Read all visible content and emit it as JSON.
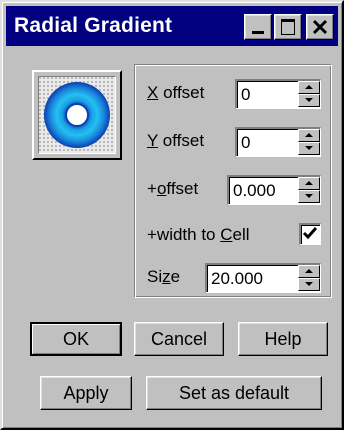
{
  "window": {
    "title": "Radial Gradient",
    "controls": [
      "minimize-icon",
      "maximize-icon",
      "close-icon"
    ]
  },
  "colors": {
    "titlebar": "#000080",
    "face": "#c0c0c0",
    "preview_ring": "#1aa0e6",
    "preview_ring_dark": "#0a3fb0"
  },
  "fields": {
    "x_offset": {
      "label_pre": "",
      "label_mnemonic": "X",
      "label_post": " offset",
      "value": "0"
    },
    "y_offset": {
      "label_pre": "",
      "label_mnemonic": "Y",
      "label_post": " offset",
      "value": "0"
    },
    "plus_offset": {
      "label_pre": "+",
      "label_mnemonic": "o",
      "label_post": "ffset",
      "value": "0.000"
    },
    "width_to_cell": {
      "label_pre": "+width to ",
      "label_mnemonic": "C",
      "label_post": "ell",
      "checked": true
    },
    "size": {
      "label_pre": "Si",
      "label_mnemonic": "z",
      "label_post": "e",
      "value": "20.000"
    }
  },
  "buttons": {
    "ok": "OK",
    "cancel": "Cancel",
    "help": "Help",
    "apply": "Apply",
    "set_default": "Set as default"
  }
}
